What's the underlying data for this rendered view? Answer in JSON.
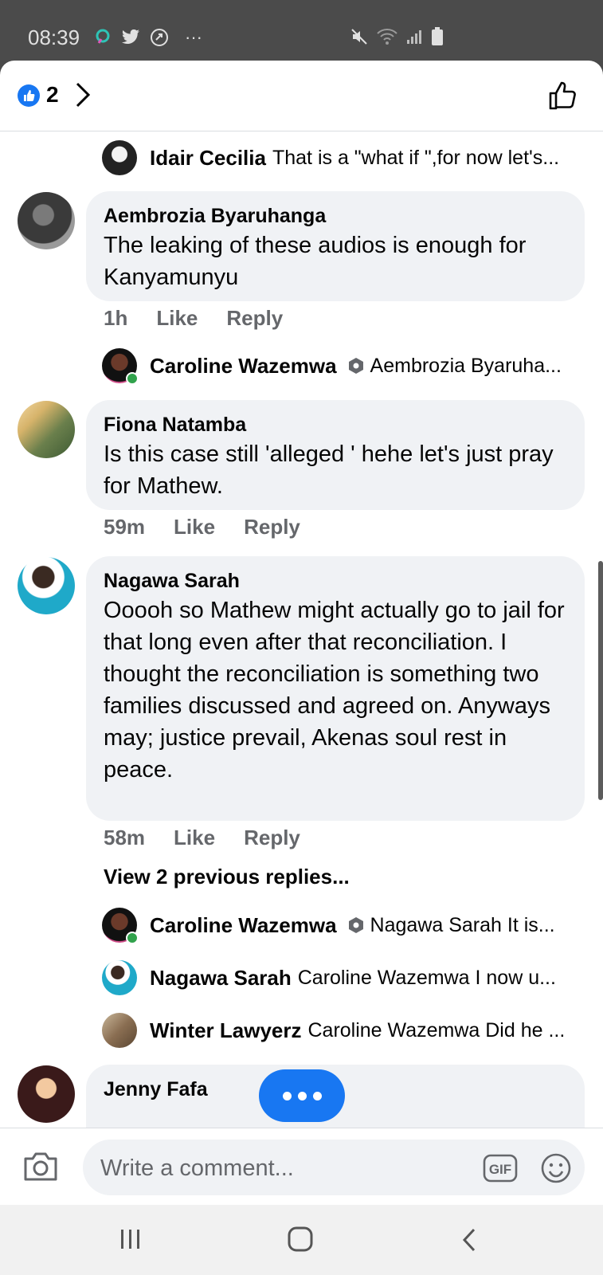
{
  "status_bar": {
    "time": "08:39",
    "dots": "···"
  },
  "header": {
    "reaction_count": "2"
  },
  "comments": [
    {
      "name": "Aembrozia Byaruhanga",
      "text": "The leaking of these audios is enough for Kanyamunyu",
      "time": "1h",
      "like": "Like",
      "reply": "Reply"
    },
    {
      "name": "Fiona Natamba",
      "text": "Is this case still 'alleged ' hehe let's just pray for Mathew.",
      "time": "59m",
      "like": "Like",
      "reply": "Reply"
    },
    {
      "name": "Nagawa Sarah",
      "text": "Ooooh so Mathew might actually go to jail for that long even after that reconciliation.  I thought the reconciliation is something two families discussed and agreed on.  Anyways may; justice prevail,  Akenas soul rest in peace.",
      "time": "58m",
      "like": "Like",
      "reply": "Reply"
    },
    {
      "name": "Jenny Fafa"
    }
  ],
  "replies": [
    {
      "name": "Idair Cecilia",
      "text": "That is a \"what if \",for now let's..."
    },
    {
      "name": "Caroline Wazemwa",
      "text": "Aembrozia Byaruha..."
    },
    {
      "name": "Caroline Wazemwa",
      "text": "Nagawa Sarah It is..."
    },
    {
      "name": "Nagawa Sarah",
      "text": "Caroline Wazemwa  I now u..."
    },
    {
      "name": "Winter Lawyerz",
      "text": "Caroline Wazemwa Did he ..."
    }
  ],
  "view_previous": "View 2 previous replies...",
  "composer": {
    "placeholder": "Write a comment...",
    "gif": "GIF"
  },
  "colors": {
    "accent": "#1877f2",
    "bubble": "#f0f2f5",
    "meta": "#65676b",
    "online": "#31a24c"
  }
}
